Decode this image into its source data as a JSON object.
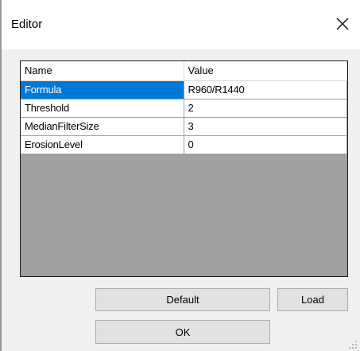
{
  "window": {
    "title": "Editor",
    "close_icon": "close-icon"
  },
  "grid": {
    "headers": [
      "Name",
      "Value"
    ],
    "rows": [
      {
        "name": "Formula",
        "value": "R960/R1440",
        "selected": true
      },
      {
        "name": "Threshold",
        "value": "2"
      },
      {
        "name": "MedianFilterSize",
        "value": "3"
      },
      {
        "name": "ErosionLevel",
        "value": "0"
      }
    ],
    "selection_color": "#0078d7",
    "empty_area_color": "#a0a0a0"
  },
  "buttons": {
    "default_label": "Default",
    "load_label": "Load",
    "ok_label": "OK"
  }
}
